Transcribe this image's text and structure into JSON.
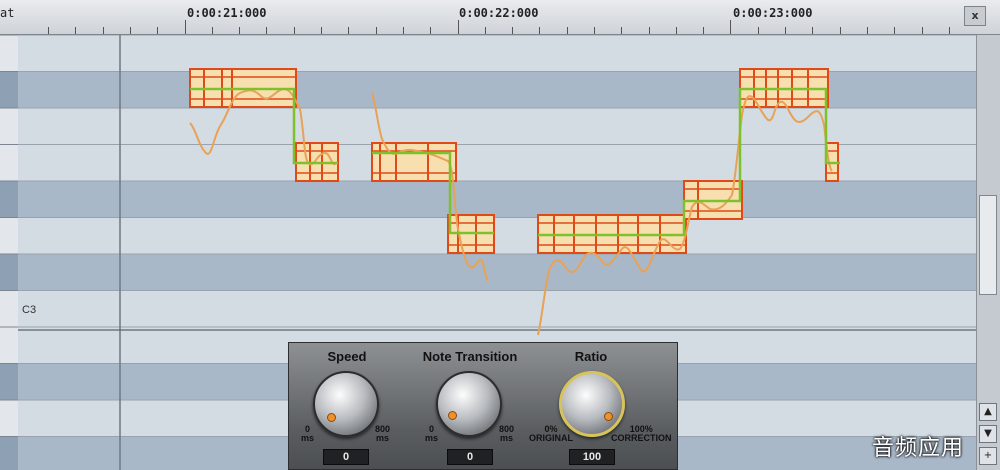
{
  "ruler": {
    "format_label": "at",
    "times": [
      "0:00:21:000",
      "0:00:22:000",
      "0:00:23:000"
    ],
    "close_label": "x"
  },
  "editor": {
    "note_label": "C3"
  },
  "panel": {
    "speed": {
      "title": "Speed",
      "min": "0\nms",
      "max": "800\nms",
      "value": "0"
    },
    "note_transition": {
      "title": "Note Transition",
      "min": "0\nms",
      "max": "800\nms",
      "value": "0"
    },
    "ratio": {
      "title": "Ratio",
      "min": "0%\nORIGINAL",
      "max": "100%\nCORRECTION",
      "value": "100"
    }
  },
  "scrollbar": {
    "up_label": "▲",
    "down_label": "▼",
    "plus_label": "+"
  },
  "watermark": "音频应用",
  "colors": {
    "pitch_curve": "#e8a257",
    "correction_line": "#7fc12a",
    "note_block_fill": "#f7dfb0",
    "note_block_border": "#e04a18",
    "dark_lane": "#a9b8c8",
    "light_lane": "#d3dbe3"
  }
}
